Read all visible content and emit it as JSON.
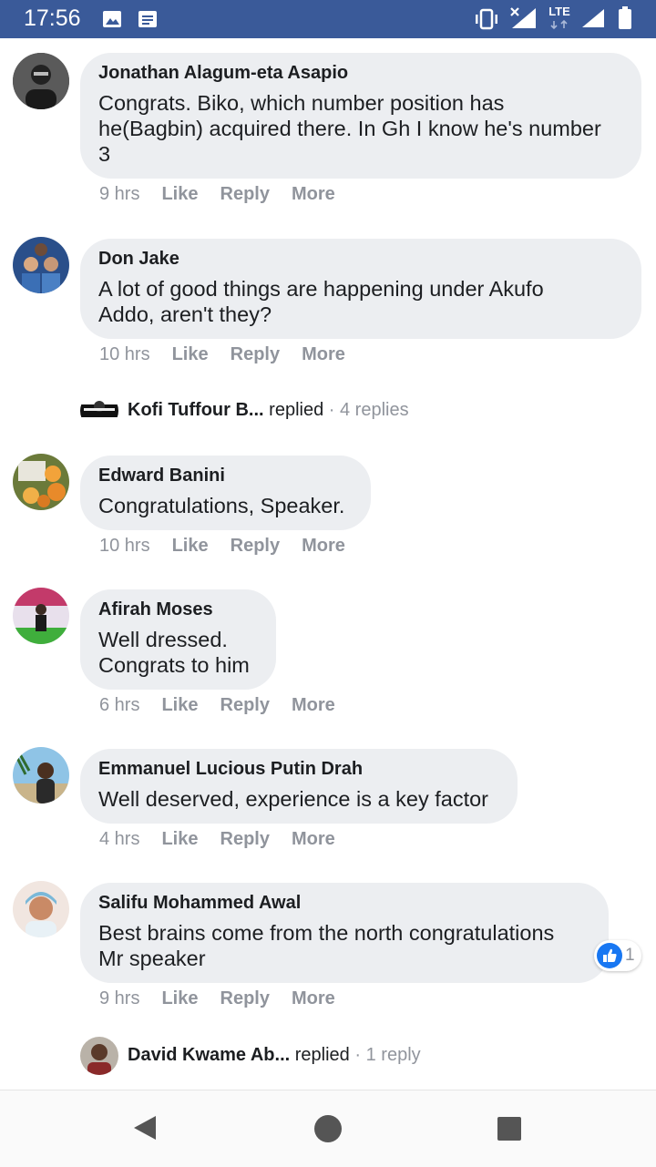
{
  "status_bar": {
    "time": "17:56",
    "network": "LTE"
  },
  "comments": [
    {
      "name": "Jonathan Alagum-eta Asapio",
      "lines": [
        "Congrats. Biko, which number position has",
        "he(Bagbin) acquired there. In Gh I know he's number",
        "3"
      ],
      "time": "9 hrs"
    },
    {
      "name": "Don Jake",
      "lines": [
        "A lot of good things are happening under Akufo",
        "Addo, aren't they?"
      ],
      "time": "10 hrs"
    },
    {
      "name": "Edward Banini",
      "lines": [
        "Congratulations, Speaker."
      ],
      "time": "10 hrs"
    },
    {
      "name": "Afirah Moses",
      "lines": [
        "Well dressed.",
        "Congrats to him"
      ],
      "time": "6 hrs"
    },
    {
      "name": "Emmanuel Lucious Putin Drah",
      "lines": [
        "Well deserved, experience is a key factor"
      ],
      "time": "4 hrs"
    },
    {
      "name": "Salifu Mohammed Awal",
      "lines": [
        "Best brains come from the north congratulations",
        "Mr speaker"
      ],
      "time": "9 hrs",
      "reaction_count": "1"
    }
  ],
  "actions": {
    "like": "Like",
    "reply": "Reply",
    "more": "More"
  },
  "reply_threads": [
    {
      "name": "Kofi Tuffour B...",
      "verb": "replied",
      "sep": "·",
      "count": "4 replies"
    },
    {
      "name": "David Kwame Ab...",
      "verb": "replied",
      "sep": "·",
      "count": "1 reply"
    }
  ],
  "colors": {
    "status_bar": "#3a5a99",
    "bubble": "#eceef1",
    "meta_text": "#90949c",
    "like_blue": "#1877f2"
  }
}
